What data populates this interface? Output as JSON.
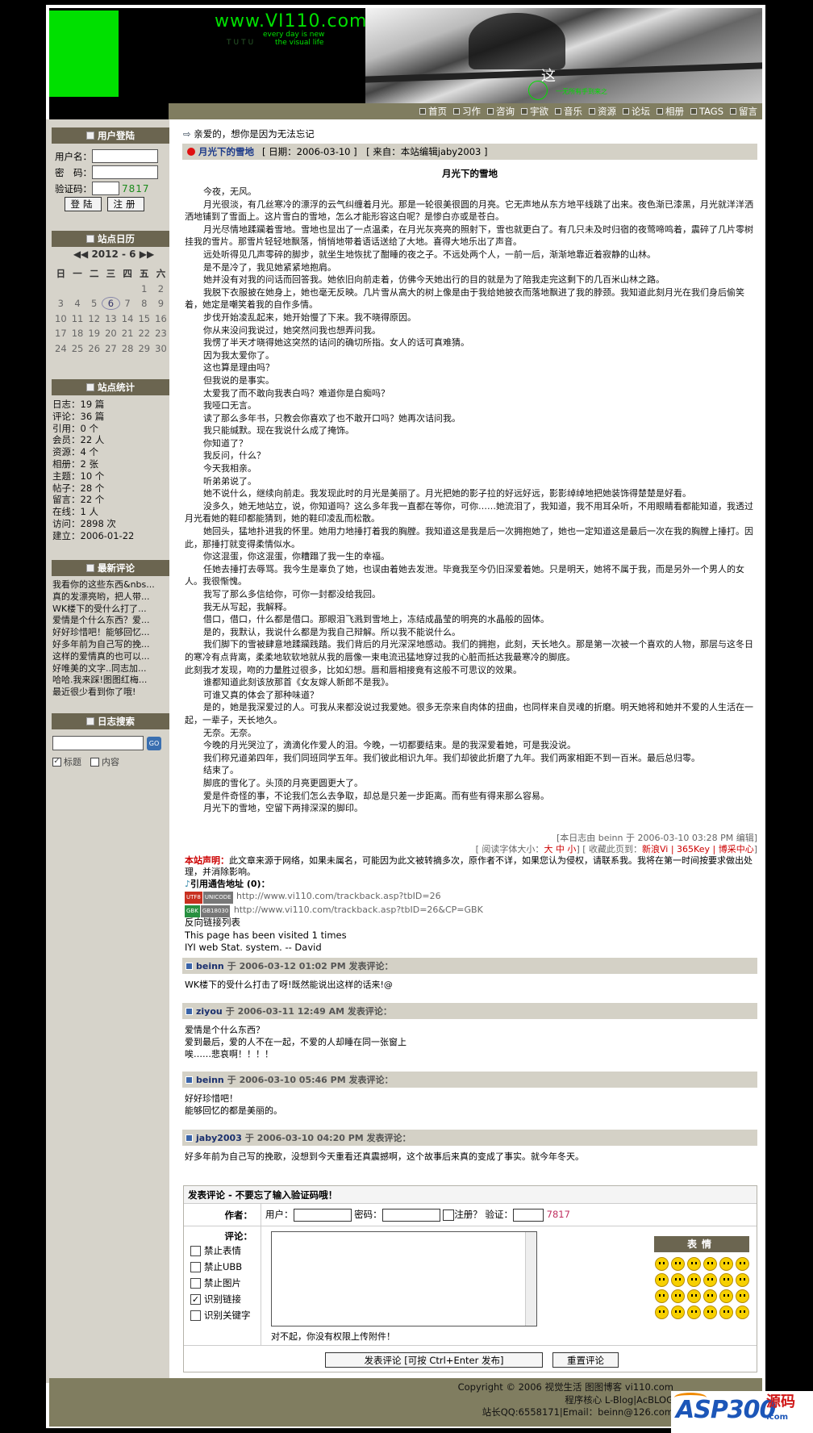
{
  "header": {
    "logo": "www.VI110.com",
    "tagline1": "every day is new",
    "tagline2": "TUTU",
    "tagline3": "the visual life",
    "photo_char": "这",
    "photo_note": "一无所有手到来之"
  },
  "nav": [
    "首页",
    "习作",
    "咨询",
    "宇欲",
    "音乐",
    "资源",
    "论坛",
    "相册",
    "TAGS",
    "留言"
  ],
  "sidebar": {
    "login": {
      "title": "用户登陆",
      "user_label": "用户名：",
      "pass_label": "密　码：",
      "code_label": "验证码：",
      "code_value": "7817",
      "login_btn": "登陆",
      "register_btn": "注册"
    },
    "calendar": {
      "title": "站点日历",
      "nav": "◀◀ 2012 - 6 ▶▶",
      "weekdays": [
        "日",
        "一",
        "二",
        "三",
        "四",
        "五",
        "六"
      ],
      "rows": [
        [
          "",
          "",
          "",
          "",
          "",
          "1",
          "2"
        ],
        [
          "3",
          "4",
          "5",
          "6",
          "7",
          "8",
          "9"
        ],
        [
          "10",
          "11",
          "12",
          "13",
          "14",
          "15",
          "16"
        ],
        [
          "17",
          "18",
          "19",
          "20",
          "21",
          "22",
          "23"
        ],
        [
          "24",
          "25",
          "26",
          "27",
          "28",
          "29",
          "30"
        ]
      ],
      "today": "6"
    },
    "stats": {
      "title": "站点统计",
      "lines": [
        "日志：19 篇",
        "评论：36 篇",
        "引用：0 个",
        "会员：22 人",
        "资源：4 个",
        "相册：2 张",
        "主题：10 个",
        "帖子：28 个",
        "留言：22 个",
        "在线：1 人",
        "访问：2898 次",
        "建立：2006-01-22"
      ]
    },
    "recent_comments": {
      "title": "最新评论",
      "items": [
        "我看你的这些东西&nbs...",
        "真的发漂亮哟，把人带...",
        "WK楼下的受什么打了...",
        "爱情是个什么东西？爱...",
        "好好珍惜吧！能够回忆...",
        "好多年前为自己写的挽...",
        "这样的爱情真的也可以...",
        "好唯美的文字..同志加...",
        "哈哈.我来踩!图图红梅...",
        "最近很少看到你了哦!"
      ]
    },
    "search": {
      "title": "日志搜索",
      "go": "GO",
      "opt_title": "标题",
      "opt_content": "内容"
    }
  },
  "main": {
    "breadcrumb": "亲爱的，想你是因为无法忘记",
    "post_title": "月光下的雪地",
    "post_meta": "[ 日期：2006-03-10 ]　[ 来自：本站编辑jaby2003 ]",
    "article_title": "月光下的雪地",
    "paragraphs": [
      "今夜，无风。",
      "月光很淡，有几丝寒冷的漂浮的云气纠缠着月光。那是一轮很美很圆的月亮。它无声地从东方地平线跳了出来。夜色渐已漆黑，月光就洋洋洒洒地铺到了雪面上。这片雪白的雪地，怎么才能形容这白呢？是惨白亦或是苍白。",
      "月光尽情地蹂躏着雪地。雪地也显出了一点温柔，在月光灰亮亮的照射下，雪也就更白了。有几只未及时归宿的夜莺啼鸣着，震碎了几片零树挂我的雪片。那雪片轻轻地飘落，悄悄地带着语话送给了大地。喜得大地乐出了声音。",
      "远处听得见几声零碎的脚步，就坐生地恢扰了酣睡的夜之子。不远处两个人，一前一后，渐渐地靠近着寂静的山林。",
      "是不是冷了，我见她紧紧地抱肩。",
      "她并没有对我的问话而回答我。她依旧向前走着，仿佛今天她出行的目的就是为了陪我走完这剩下的几百米山林之路。",
      "我脱下衣服披在她身上，她也毫无反映。几片雪从高大的树上像是由于我给她披衣而落地飘进了我的脖颈。我知道此刻月光在我们身后偷笑着，她定是嘲笑着我的自作多情。",
      "步伐开始凌乱起来，她开始慢了下来。我不晓得原因。",
      "你从来没问我说过，她突然问我也想弄问我。",
      "我愣了半天才晓得她这突然的诘问的确切所指。女人的话可真难猜。",
      "因为我太爱你了。",
      "这也算是理由吗？",
      "但我说的是事实。",
      "太爱我了而不敢向我表白吗？难道你是白痴吗？",
      "我哑口无言。",
      "读了那么多年书，只教会你喜欢了也不敢开口吗？她再次诘问我。",
      "我只能缄默。现在我说什么成了掩饰。",
      "你知道了？",
      "我反问，什么？",
      "今天我相亲。",
      "听弟弟说了。",
      "她不说什么，继续向前走。我发现此时的月光是美丽了。月光把她的影子拉的好远好远，影影绰绰地把她装饰得楚楚是好看。",
      "没多久，她无地站立，说，你知道吗？这么多年我一直都在等你，可你……她流泪了，我知道，我不用耳朵听，不用眼睛看都能知道，我透过月光看她的鞋印都能猜到，她的鞋印凌乱而松散。",
      "她回头，猛地扑进我的怀里。她用力地捶打着我的胸膛。我知道这是我是后一次拥抱她了，她也一定知道这是最后一次在我的胸膛上捶打。因此，那捶打就变得柔情似水。",
      "你这混蛋，你这混蛋，你糟蹋了我一生的幸福。",
      "任她去捶打去辱骂。我今生是辜负了她，也误由着她去发泄。毕竟我至今仍旧深爱着她。只是明天，她将不属于我，而是另外一个男人的女人。我很惭愧。",
      "我写了那么多信给你，可你一封都没给我回。",
      "我无从写起，我解释。",
      "借口，借口，什么都是借口。那眼泪飞溅到雪地上，冻结成晶莹的明亮的水晶般的固体。",
      "是的，我默认，我说什么都是为我自己辩解。所以我不能说什么。",
      "我们脚下的雪被肆意地蹂躏践踏。我们背后的月光深深地感动。我们的拥抱，此刻，天长地久。那是第一次被一个喜欢的人物，那层与这冬日的寒冷有点背离，柔柔地软软地就从我的唇像一束电流迅猛地穿过我的心脏而抵达我最寒冷的脚底。",
      "此刻我才发现，吻的力量胜过很多，比如幻想。唇和唇相接竟有这般不可思议的效果。",
      "谁都知道此刻该放那首《女友嫁人新郎不是我》。",
      "可谁又真的体会了那种味道？",
      "是的，她是我深爱过的人。可我从来都没说过我爱她。很多无奈来自肉体的扭曲，也同样来自灵魂的折磨。明天她将和她并不爱的人生活在一起，一辈子，天长地久。",
      "无奈。无奈。",
      "今晚的月光哭泣了，滴滴化作爱人的泪。今晚，一切都要结束。是的我深爱着她，可是我没说。",
      "我们称兄道弟四年，我们同班同学五年。我们彼此相识九年。我们却彼此折磨了九年。我们两家相距不到一百米。最后总归零。",
      "结束了。",
      "脚底的雪化了。头顶的月亮更圆更大了。",
      "爱是件奇怪的事，不论我们怎么去争取，却总是只差一步距离。而有些有得来那么容易。",
      "月光下的雪地，空留下两排深深的脚印。"
    ],
    "noindent_index": 31,
    "edit_note": "[本日志由 beinn 于 2006-03-10 03:28 PM 编辑]",
    "font_size_label": "[ 阅读字体大小：",
    "font_sizes": "大 中 小",
    "bookmark_label": "] [ 收藏此页到：",
    "bookmarks": "新浪Vi | 365Key | 博采中心",
    "bookmark_end": "]",
    "decl_label": "本站声明：",
    "decl_text": "此文章来源于网络，如果未属名，可能因为此文被转摘多次，原作者不详，如果您认为侵权，请联系我。我将在第一时间按要求做出处理，并消除影响。",
    "trackback_title": "引用通告地址 (0)：",
    "trackback_utf8_badge": "UTF8",
    "trackback_utf8_badge2": "UNICODE",
    "trackback_utf8_url": "http://www.vi110.com/trackback.asp?tbID=26",
    "trackback_gbk_badge": "GBK",
    "trackback_gbk_badge2": "GB18030",
    "trackback_gbk_url": "http://www.vi110.com/trackback.asp?tbID=26&CP=GBK",
    "backlinks": "反向链接列表",
    "visited": "This page has been visited 1 times",
    "stat_system": "IYI web Stat. system. -- David"
  },
  "comments": [
    {
      "author": "beinn",
      "meta": "于 2006-03-12 01:02 PM 发表评论：",
      "lines": [
        "WK楼下的受什么打击了呀!既然能说出这样的话来!@"
      ]
    },
    {
      "author": "ziyou",
      "meta": "于 2006-03-11 12:49 AM 发表评论：",
      "lines": [
        "爱情是个什么东西？",
        "爱到最后，爱的人不在一起，不爱的人却睡在同一张窗上",
        "唉……悲哀啊！！！！"
      ]
    },
    {
      "author": "beinn",
      "meta": "于 2006-03-10 05:46 PM 发表评论：",
      "lines": [
        "好好珍惜吧！",
        "能够回忆的都是美丽的。"
      ]
    },
    {
      "author": "jaby2003",
      "meta": "于 2006-03-10 04:20 PM 发表评论：",
      "lines": [
        "好多年前为自己写的挽歌，没想到今天重看还真震撼啊，这个故事后来真的变成了事实。就今年冬天。"
      ]
    }
  ],
  "comment_form": {
    "title": "发表评论 - 不要忘了输入验证码哦！",
    "author_label": "作者：",
    "user_label": "用户：",
    "pass_label": "密码：",
    "register_label": "注册？",
    "verify_label": "验证：",
    "verify_code": "7817",
    "comment_label": "评论：",
    "options": [
      "禁止表情",
      "禁止UBB",
      "禁止图片",
      "识别链接",
      "识别关键字"
    ],
    "options_checked": [
      false,
      false,
      false,
      true,
      false
    ],
    "no_attach": "对不起，你没有权限上传附件！",
    "emo_title": "表情",
    "submit_btn": "发表评论 [可按 Ctrl+Enter 发布]",
    "reset_btn": "重置评论"
  },
  "footer": {
    "line1": "Copyright © 2006 视觉生活 图图博客 vi110.com",
    "line2": "程序核心 L-Blog|AcBLOG",
    "line3": "站长QQ:6558171|Email：beinn@126.com"
  },
  "watermark": {
    "asp": "ASP300",
    "src": "源码",
    "dom": ".com"
  },
  "colors": {
    "nav_bg": "#807d60",
    "sidebar_bg": "#d6d3ca",
    "title_bar": "#d4d1c6",
    "box_title": "#6b6550",
    "accent_green": "#00e000",
    "link_blue": "#1c3a8a"
  }
}
